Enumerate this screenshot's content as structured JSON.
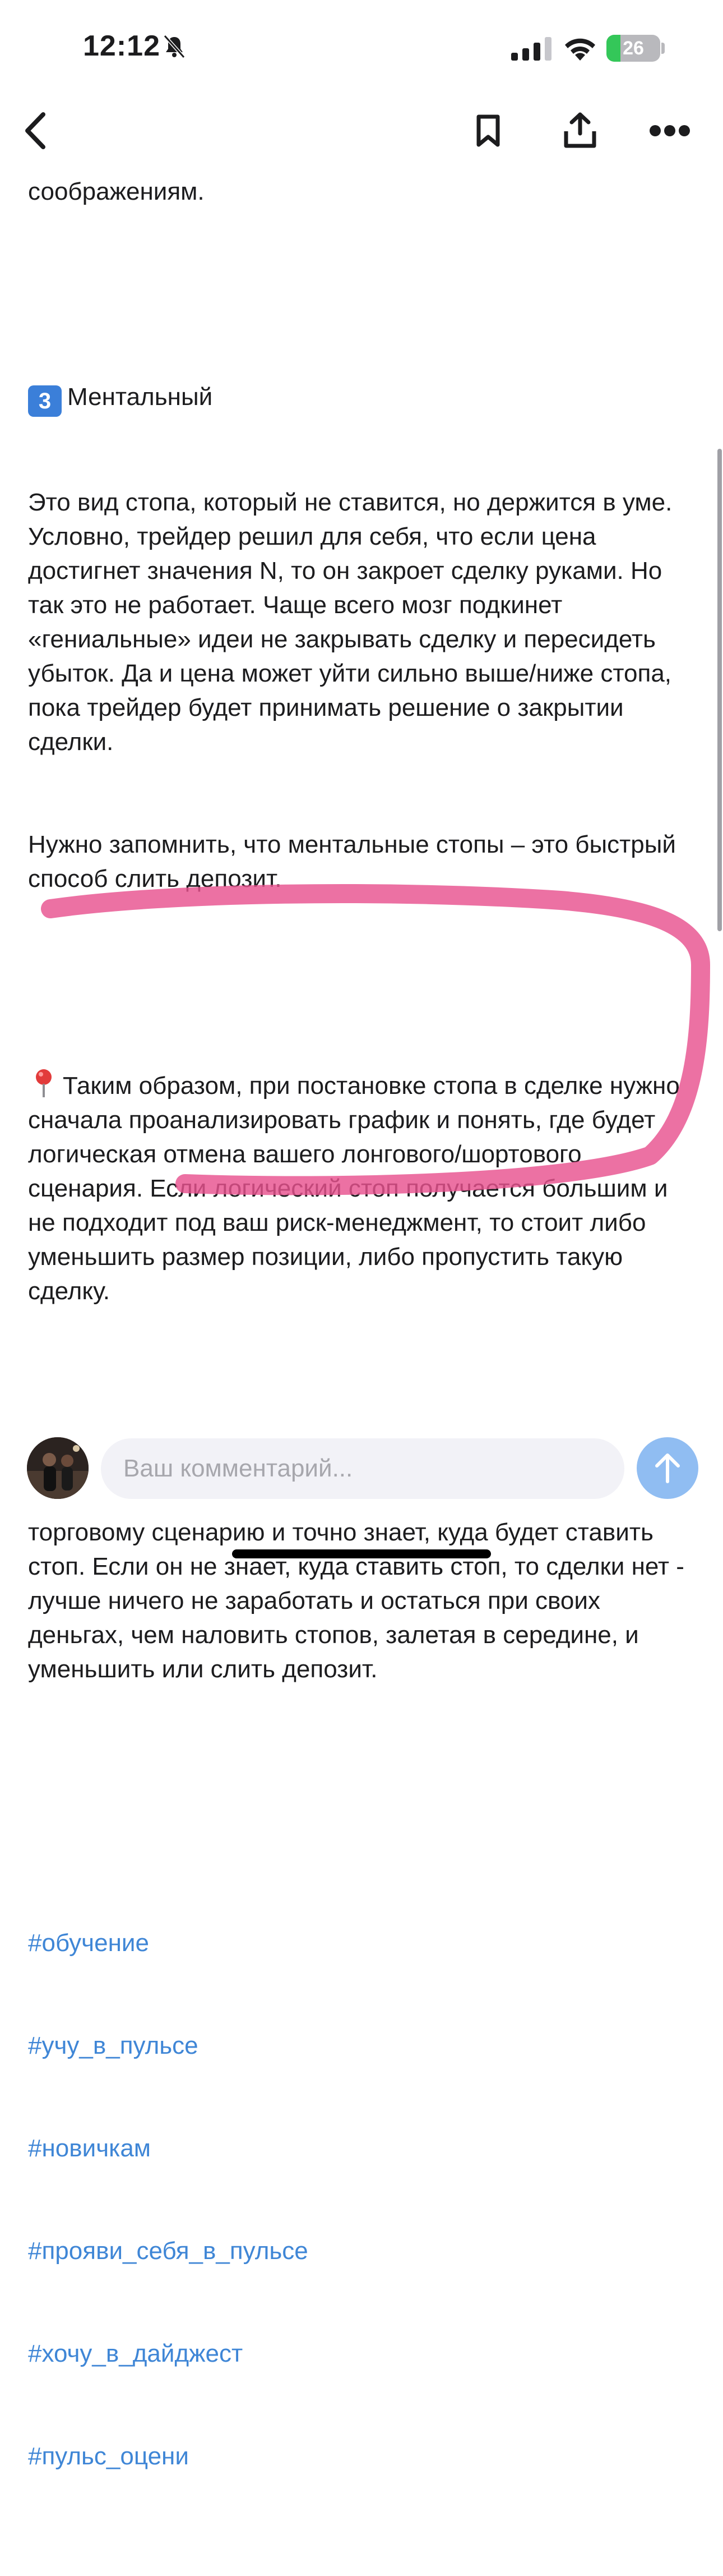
{
  "status_bar": {
    "time": "12:12",
    "battery_level": "26",
    "battery_fraction": 0.26
  },
  "nav": {
    "back_icon": "chevron-left-icon",
    "bookmark_icon": "bookmark-icon",
    "share_icon": "share-icon",
    "more_icon": "more-icon"
  },
  "article": {
    "cut_line": "соображениям.",
    "section_number": "3",
    "section_title": "Ментальный",
    "p1": "Это вид стопа, который не ставится, но держится в уме. Условно, трейдер решил для себя, что если цена достигнет значения N, то он закроет сделку руками. Но так это не работает. Чаще всего мозг подкинет «гениальные» идеи не закрывать сделку и пересидеть убыток. Да и цена может уйти сильно выше/ниже стопа, пока трейдер будет принимать решение о закрытии сделки.",
    "p2": "Нужно запомнить, что ментальные стопы – это быстрый способ слить депозит.",
    "p3": "Таким образом, при постановке стопа в сделке нужно сначала проанализировать график и понять, где будет логическая отмена вашего лонгового/шортового сценария. Если логический стоп получается большим и не подходит под ваш риск-менеджмент, то стоит либо уменьшить размер позиции, либо пропустить такую сделку.",
    "p4": "ВАЖНО: опытный трейдер действует по своему торговому сценарию и точно знает, куда будет ставить стоп. Если он не знает, куда ставить стоп, то сделки нет - лучше ничего не заработать и остаться при своих деньгах, чем наловить стопов, залетая в середине, и уменьшить или слить депозит.",
    "hashtags": [
      "#обучение",
      "#учу_в_пульсе",
      "#новичкам",
      "#прояви_себя_в_пульсе",
      "#хочу_в_дайджест",
      "#пульс_оцени"
    ]
  },
  "comment": {
    "placeholder": "Ваш комментарий...",
    "value": ""
  },
  "colors": {
    "hashtag": "#3f86d6",
    "highlight": "#e8528f",
    "send_button": "#90bdf2"
  }
}
